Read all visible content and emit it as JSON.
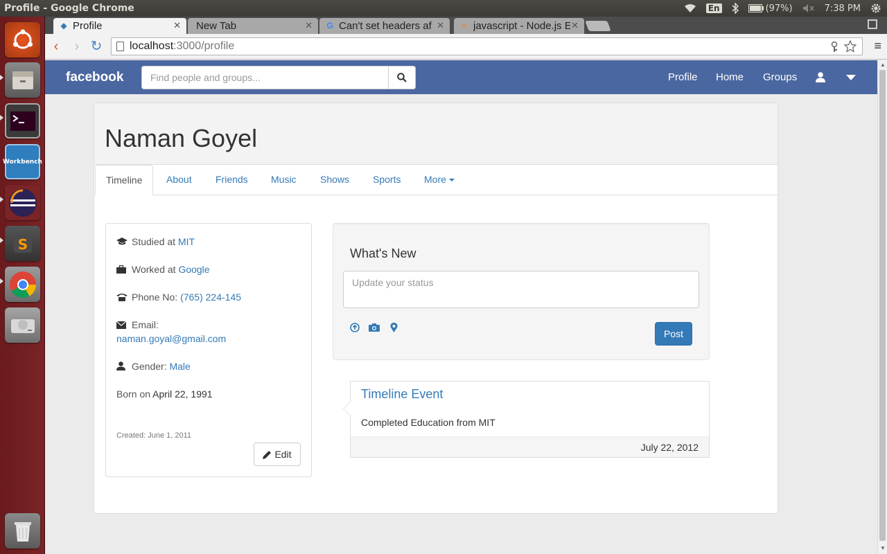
{
  "window": {
    "title": "Profile - Google Chrome"
  },
  "system": {
    "language": "En",
    "battery": "(97%)",
    "time": "7:38 PM"
  },
  "browser": {
    "tabs": [
      {
        "label": "Profile"
      },
      {
        "label": "New Tab"
      },
      {
        "label": "Can't set headers af"
      },
      {
        "label": "javascript - Node.js E"
      }
    ],
    "url_host": "localhost",
    "url_path": ":3000/profile"
  },
  "navbar": {
    "brand": "facebook",
    "search_placeholder": "Find people and groups...",
    "links": {
      "profile": "Profile",
      "home": "Home",
      "groups": "Groups"
    }
  },
  "profile": {
    "name": "Naman Goyel",
    "tabs": [
      "Timeline",
      "About",
      "Friends",
      "Music",
      "Shows",
      "Sports",
      "More"
    ]
  },
  "info": {
    "studied_label": "Studied at",
    "studied_value": "MIT",
    "worked_label": "Worked at",
    "worked_value": "Google",
    "phone_label": "Phone No:",
    "phone_value": "(765) 224-145",
    "email_label": "Email:",
    "email_value": "naman.goyal@gmail.com",
    "gender_label": "Gender:",
    "gender_value": "Male",
    "born_label": "Born on",
    "born_value": "April 22, 1991",
    "created": "Created: June 1, 2011",
    "edit_label": "Edit"
  },
  "whats_new": {
    "title": "What's New",
    "placeholder": "Update your status",
    "post_label": "Post"
  },
  "timeline_event": {
    "title": "Timeline Event",
    "body": "Completed Education from MIT",
    "date": "July 22, 2012"
  },
  "colors": {
    "fb_blue": "#4b67a1",
    "link": "#337ab7",
    "launcher": "#7a2427"
  }
}
